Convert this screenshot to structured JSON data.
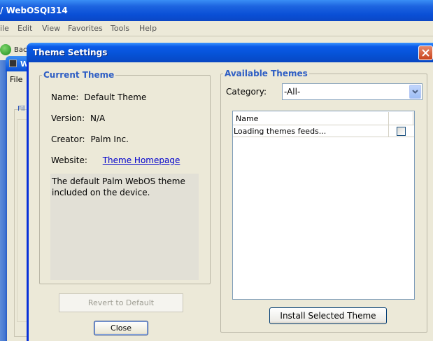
{
  "background_window": {
    "title": "WebOSQI314",
    "title_prefix": "/",
    "menu": [
      "ile",
      "Edit",
      "View",
      "Favorites",
      "Tools",
      "Help"
    ],
    "back_label": "Bac",
    "child_window_letter": "W",
    "child_menu_file": "File",
    "child_group_label": "Fil"
  },
  "dialog": {
    "title": "Theme Settings",
    "current_theme": {
      "legend": "Current Theme",
      "name_label": "Name:",
      "name_value": "Default Theme",
      "version_label": "Version:",
      "version_value": "N/A",
      "creator_label": "Creator:",
      "creator_value": "Palm Inc.",
      "website_label": "Website:",
      "website_link": "Theme Homepage",
      "description": "The default Palm WebOS theme\nincluded on the device."
    },
    "revert_button": "Revert to Default",
    "close_button": "Close",
    "available_themes": {
      "legend": "Available Themes",
      "category_label": "Category:",
      "category_value": "-All-",
      "table": {
        "header_name": "Name",
        "rows": [
          {
            "name": "Loading themes feeds...",
            "checked": false
          }
        ]
      },
      "install_button": "Install Selected Theme"
    }
  },
  "icons": [
    "back-arrow-icon",
    "window-icon",
    "close-x-icon",
    "dropdown-arrow-icon"
  ]
}
